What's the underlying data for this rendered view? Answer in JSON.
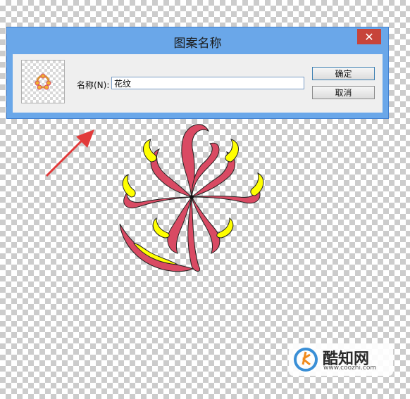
{
  "dialog": {
    "title": "图案名称",
    "close_label": "✕",
    "name_label": "名称(N):",
    "name_value": "花纹",
    "ok_label": "确定",
    "cancel_label": "取消"
  },
  "watermark": {
    "site_name": "酷知网",
    "url": "www.coozhi.com"
  },
  "colors": {
    "ornament_outline": "#d94a63",
    "ornament_fill": "#ffff00",
    "arrow": "#e23a3a",
    "titlebar": "#6aa7e9"
  }
}
